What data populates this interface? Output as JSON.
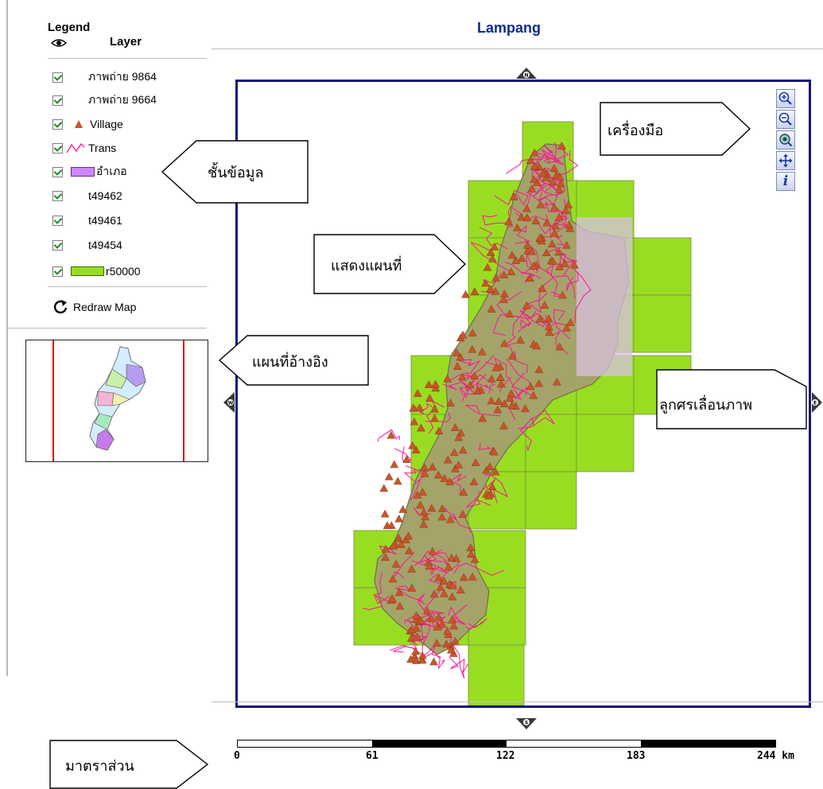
{
  "legend": {
    "title": "Legend",
    "layer_header": "Layer",
    "layers": [
      {
        "label": "ภาพถ่าย 9864",
        "checked": true
      },
      {
        "label": "ภาพถ่าย 9664",
        "checked": true
      },
      {
        "label": "Village",
        "checked": true,
        "symbol": "triangle-icon"
      },
      {
        "label": "Trans",
        "checked": true,
        "symbol": "line-icon"
      },
      {
        "label": "อำเภอ",
        "checked": true,
        "symbol": "purple-fill"
      },
      {
        "label": "t49462",
        "checked": true
      },
      {
        "label": "t49461",
        "checked": true
      },
      {
        "label": "t49454",
        "checked": true
      },
      {
        "label": "r50000",
        "checked": true,
        "symbol": "green-fill"
      }
    ],
    "redraw_label": "Redraw Map"
  },
  "map": {
    "title": "Lampang",
    "pan_labels": {
      "north": "N",
      "south": "S",
      "east": "E",
      "west": "W"
    }
  },
  "toolbar": {
    "tools": [
      "zoom-in-icon",
      "zoom-out-icon",
      "full-extent-icon",
      "pan-icon",
      "identify-icon"
    ],
    "identify_glyph": "i"
  },
  "callouts": {
    "tools": "เครื่องมือ",
    "layers": "ชั้นข้อมูล",
    "map_display": "แสดงแผนที่",
    "reference_map": "แผนที่อ้างอิง",
    "pan_arrows": "ลูกศรเลื่อนภาพ",
    "scale": "มาตราส่วน"
  },
  "scale_bar": {
    "ticks": [
      "0",
      "61",
      "122",
      "183",
      "244 km"
    ]
  },
  "colors": {
    "frame": "#13137a",
    "title": "#0e2a8a",
    "grid_fill": "#99dd22",
    "province_fill": "#a4a36a",
    "roads": "#ff1493",
    "villages": "#c8552a"
  }
}
